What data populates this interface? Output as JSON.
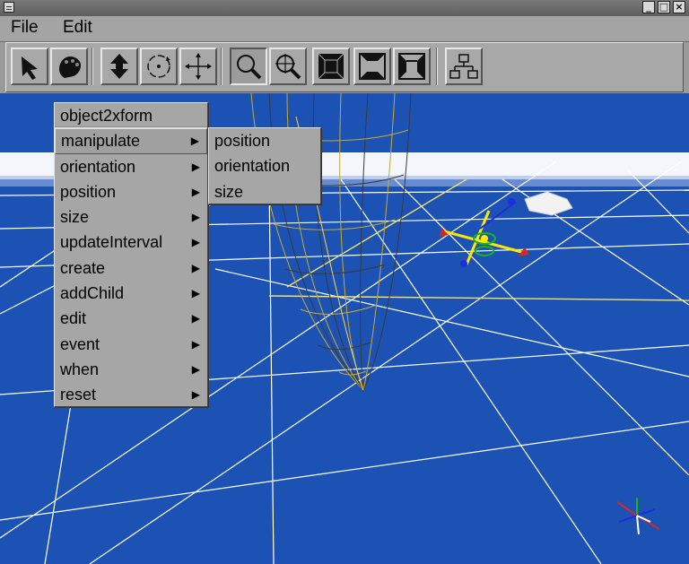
{
  "window": {
    "controls": {
      "minimize": "_",
      "maximize": "□",
      "close": "×"
    }
  },
  "menubar": {
    "file": "File",
    "edit": "Edit"
  },
  "toolbar": {
    "buttons": [
      {
        "icon": "select-arrow-icon",
        "state": "normal"
      },
      {
        "icon": "hand-icon",
        "state": "normal"
      },
      {
        "icon": "translate-vertical-icon",
        "state": "normal"
      },
      {
        "icon": "rotate-icon",
        "state": "normal"
      },
      {
        "icon": "move-icon",
        "state": "normal"
      },
      {
        "icon": "zoom-icon",
        "state": "pressed"
      },
      {
        "icon": "zoom-plus-icon",
        "state": "normal"
      },
      {
        "icon": "view-front-icon",
        "state": "normal"
      },
      {
        "icon": "view-perspective-icon",
        "state": "normal"
      },
      {
        "icon": "view-side-icon",
        "state": "normal"
      },
      {
        "icon": "scene-tree-icon",
        "state": "normal"
      }
    ]
  },
  "context_menu": {
    "header": "object2xform",
    "items": [
      {
        "label": "manipulate",
        "submenu": true,
        "active": true
      },
      {
        "label": "orientation",
        "submenu": true
      },
      {
        "label": "position",
        "submenu": true
      },
      {
        "label": "size",
        "submenu": true
      },
      {
        "label": "updateInterval",
        "submenu": true
      },
      {
        "label": "create",
        "submenu": true
      },
      {
        "label": "addChild",
        "submenu": true
      },
      {
        "label": "edit",
        "submenu": true
      },
      {
        "label": "event",
        "submenu": true
      },
      {
        "label": "when",
        "submenu": true
      },
      {
        "label": "reset",
        "submenu": true
      }
    ],
    "arrow": "▶"
  },
  "submenu": {
    "items": [
      {
        "label": "position"
      },
      {
        "label": "orientation"
      },
      {
        "label": "size"
      }
    ]
  },
  "colors": {
    "viewport_bg": "#1c52b4",
    "grid": "#ffffff",
    "wireframe_a": "#c8a830",
    "wireframe_b": "#3a3a3a",
    "axis_x": "#ffe800",
    "handle_red": "#d42828",
    "handle_blue": "#1e2ce0",
    "handle_green": "#18b418"
  }
}
